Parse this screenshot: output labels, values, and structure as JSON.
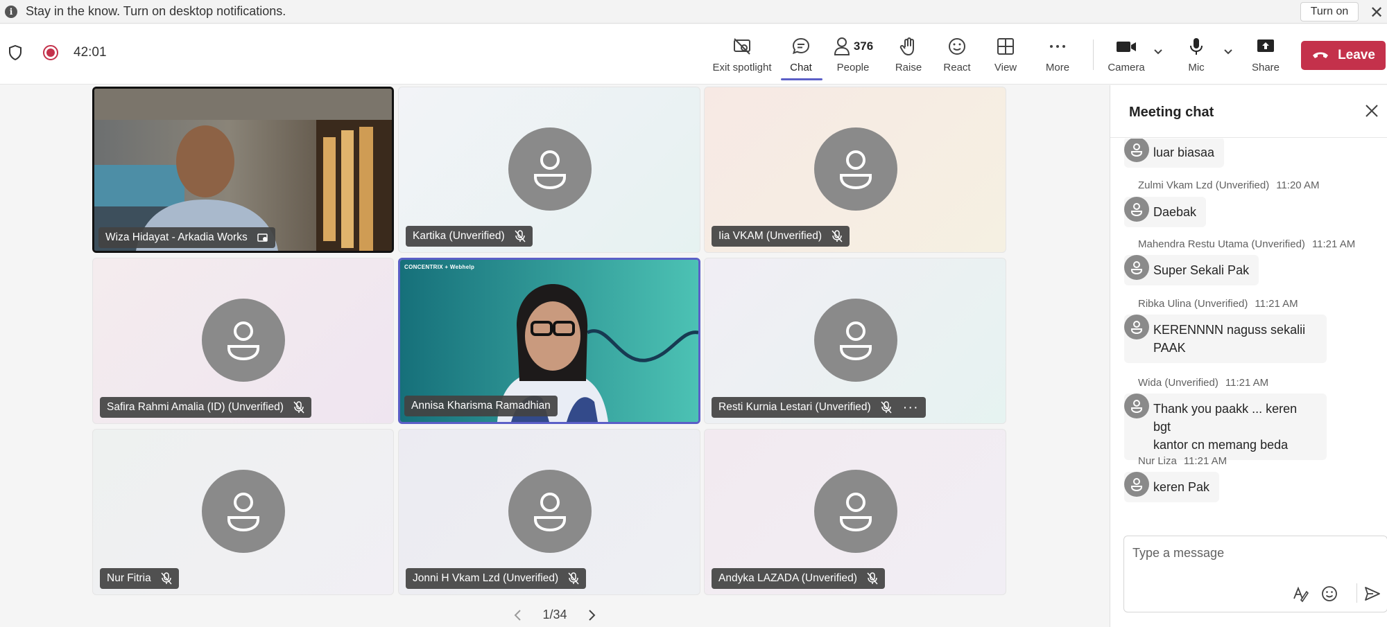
{
  "notification": {
    "message": "Stay in the know. Turn on desktop notifications.",
    "turn_on_label": "Turn on"
  },
  "header": {
    "timer": "42:01"
  },
  "toolbar": {
    "exit_spotlight": "Exit spotlight",
    "chat": "Chat",
    "people": "People",
    "people_count": "376",
    "raise": "Raise",
    "react": "React",
    "view": "View",
    "more": "More",
    "camera": "Camera",
    "mic": "Mic",
    "share": "Share",
    "leave": "Leave"
  },
  "participants": [
    {
      "name": "Wiza Hidayat - Arkadia Works",
      "video": true
    },
    {
      "name": "Kartika (Unverified)",
      "muted": true
    },
    {
      "name": "Iia VKAM (Unverified)",
      "muted": true
    },
    {
      "name": "Safira Rahmi Amalia (ID) (Unverified)",
      "muted": true
    },
    {
      "name": "Annisa Kharisma Ramadhian",
      "video": true,
      "active": true
    },
    {
      "name": "Resti Kurnia Lestari (Unverified)",
      "muted": true
    },
    {
      "name": "Nur Fitria",
      "muted": true
    },
    {
      "name": "Jonni H Vkam Lzd (Unverified)",
      "muted": true
    },
    {
      "name": "Andyka LAZADA (Unverified)",
      "muted": true
    }
  ],
  "video_overlay": {
    "brand": "CONCENTRIX + Webhelp"
  },
  "pager": {
    "label": "1/34"
  },
  "chat": {
    "title": "Meeting chat",
    "messages": [
      {
        "text": "luar biasaa"
      },
      {
        "sender": "Zulmi Vkam Lzd (Unverified)",
        "time": "11:20 AM",
        "text": "Daebak"
      },
      {
        "sender": "Mahendra Restu Utama (Unverified)",
        "time": "11:21 AM",
        "text": "Super Sekali Pak"
      },
      {
        "sender": "Ribka Ulina (Unverified)",
        "time": "11:21 AM",
        "text_line1": "KERENNNN naguss sekalii",
        "text_line2": "PAAK"
      },
      {
        "sender": "Wida (Unverified)",
        "time": "11:21 AM",
        "text_line1": "Thank you paakk ... keren bgt",
        "text_line2": "kantor cn memang beda"
      },
      {
        "sender": "Nur Liza",
        "time": "11:21 AM",
        "text": "keren Pak"
      }
    ],
    "composer_placeholder": "Type a message"
  },
  "colors": {
    "accent": "#5b5fc7",
    "leave": "#c4314b",
    "recording": "#c4314b",
    "avatar": "#8a8a8a"
  }
}
